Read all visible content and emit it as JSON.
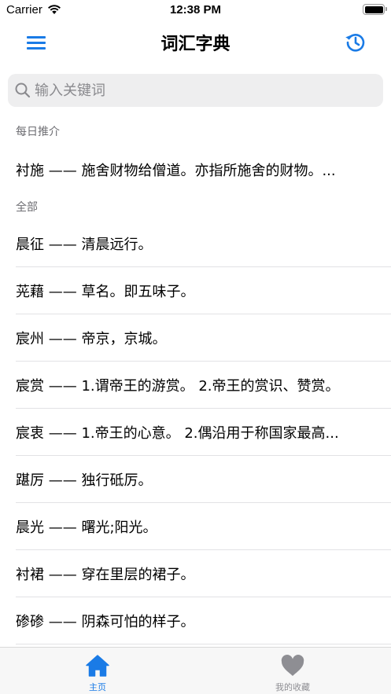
{
  "status_bar": {
    "carrier": "Carrier",
    "time": "12:38 PM",
    "icons": [
      "wifi-icon",
      "battery-icon"
    ]
  },
  "nav": {
    "title": "词汇字典",
    "left_icon": "menu-icon",
    "right_icon": "history-icon",
    "accent_color": "#1a7be6"
  },
  "search": {
    "placeholder": "输入关键词",
    "value": "",
    "icon": "search-icon"
  },
  "daily": {
    "header": "每日推介",
    "item": "衬施 —— 施舍财物给僧道。亦指所施舍的财物。..."
  },
  "all": {
    "header": "全部",
    "items": [
      "晨征 —— 清晨远行。",
      "茪藉 —— 草名。即五味子。",
      "宸州 —— 帝京，京城。",
      "宸赏 —— 1.谓帝王的游赏。 2.帝王的赏识、赞赏。",
      "宸衷 —— 1.帝王的心意。 2.偶沿用于称国家最高...",
      "踸厉 —— 独行砥厉。",
      "晨光 —— 曙光;阳光。",
      "衬裙 —— 穿在里层的裙子。",
      "碜碜 —— 阴森可怕的样子。"
    ]
  },
  "tab_bar": {
    "tabs": [
      {
        "label": "主页",
        "icon": "home-icon",
        "active": true
      },
      {
        "label": "我的收藏",
        "icon": "heart-icon",
        "active": false
      }
    ],
    "active_color": "#1a7be6",
    "inactive_color": "#8e8e93"
  }
}
